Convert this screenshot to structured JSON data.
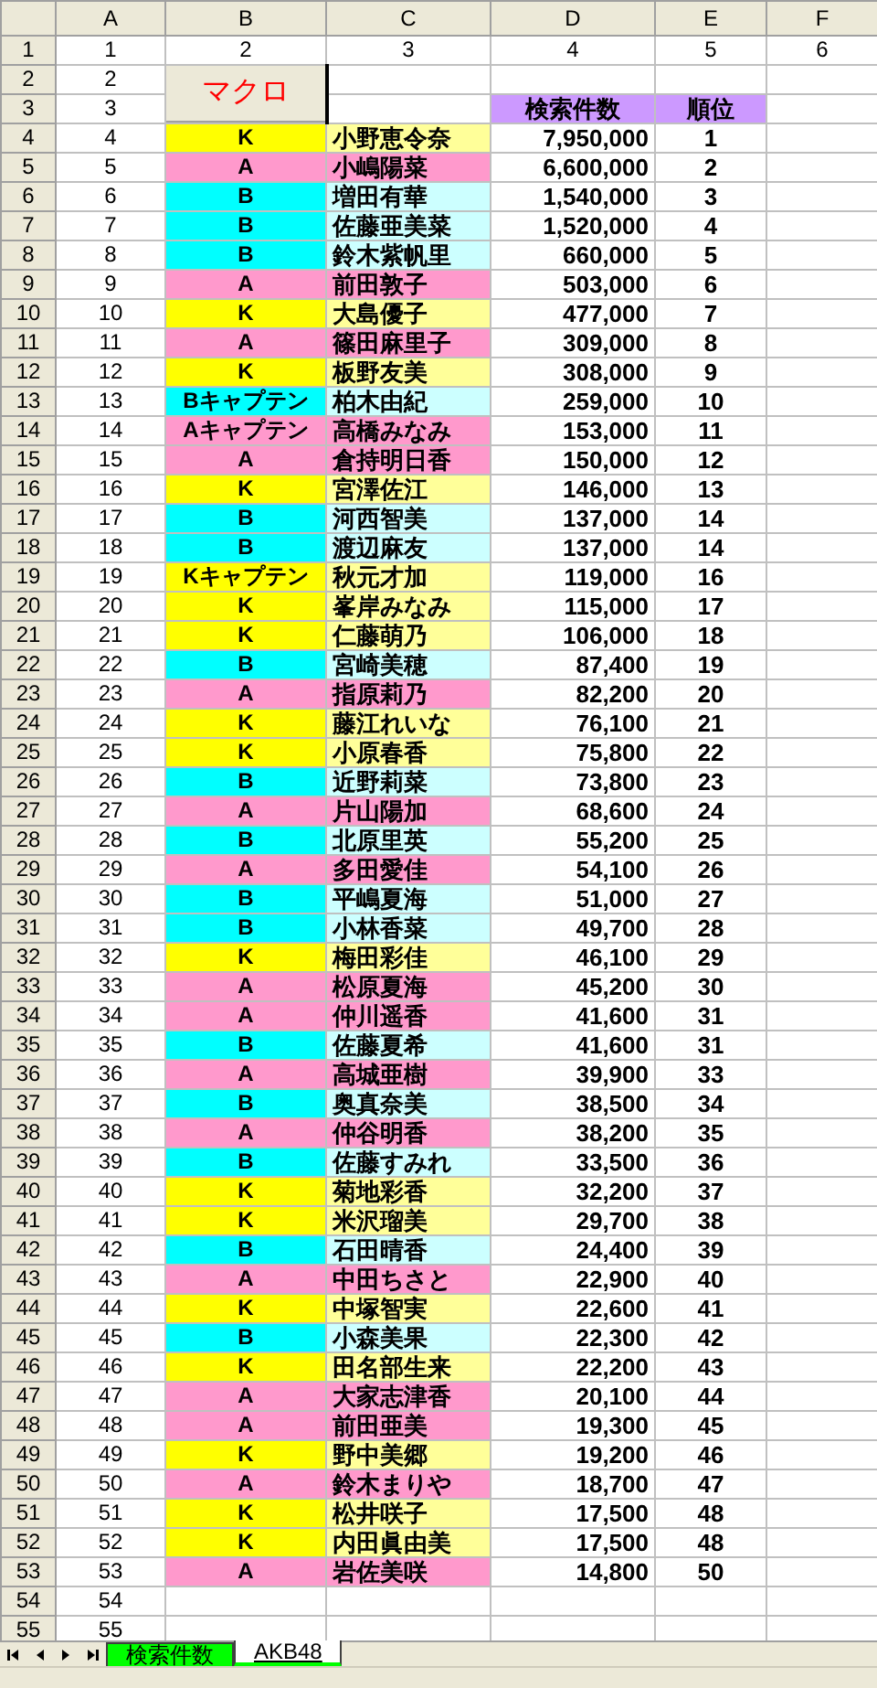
{
  "column_headers": [
    "A",
    "B",
    "C",
    "D",
    "E",
    "F"
  ],
  "row_numbers": [
    "1",
    "2",
    "3",
    "4",
    "5",
    "6",
    "7",
    "8",
    "9",
    "10",
    "11",
    "12",
    "13",
    "14",
    "15",
    "16",
    "17",
    "18",
    "19",
    "20",
    "21",
    "22",
    "23",
    "24",
    "25",
    "26",
    "27",
    "28",
    "29",
    "30",
    "31",
    "32",
    "33",
    "34",
    "35",
    "36",
    "37",
    "38",
    "39",
    "40",
    "41",
    "42",
    "43",
    "44",
    "45",
    "46",
    "47",
    "48",
    "49",
    "50",
    "51",
    "52",
    "53",
    "54",
    "55"
  ],
  "column_a": [
    "1",
    "2",
    "3",
    "4",
    "5",
    "6",
    "7",
    "8",
    "9",
    "10",
    "11",
    "12",
    "13",
    "14",
    "15",
    "16",
    "17",
    "18",
    "19",
    "20",
    "21",
    "22",
    "23",
    "24",
    "25",
    "26",
    "27",
    "28",
    "29",
    "30",
    "31",
    "32",
    "33",
    "34",
    "35",
    "36",
    "37",
    "38",
    "39",
    "40",
    "41",
    "42",
    "43",
    "44",
    "45",
    "46",
    "47",
    "48",
    "49",
    "50",
    "51",
    "52",
    "53",
    "54",
    "55"
  ],
  "row_1": [
    "2",
    "3",
    "4",
    "5",
    "6"
  ],
  "macro_button": "マクロ",
  "headers": {
    "count": "検索件数",
    "rank": "順位"
  },
  "members": [
    {
      "kind": "K",
      "team": "K",
      "name": "小野恵令奈",
      "count": "7,950,000",
      "rank": "1"
    },
    {
      "kind": "A",
      "team": "A",
      "name": "小嶋陽菜",
      "count": "6,600,000",
      "rank": "2"
    },
    {
      "kind": "B",
      "team": "B",
      "name": "増田有華",
      "count": "1,540,000",
      "rank": "3"
    },
    {
      "kind": "B",
      "team": "B",
      "name": "佐藤亜美菜",
      "count": "1,520,000",
      "rank": "4"
    },
    {
      "kind": "B",
      "team": "B",
      "name": "鈴木紫帆里",
      "count": "660,000",
      "rank": "5"
    },
    {
      "kind": "A",
      "team": "A",
      "name": "前田敦子",
      "count": "503,000",
      "rank": "6"
    },
    {
      "kind": "K",
      "team": "K",
      "name": "大島優子",
      "count": "477,000",
      "rank": "7"
    },
    {
      "kind": "A",
      "team": "A",
      "name": "篠田麻里子",
      "count": "309,000",
      "rank": "8"
    },
    {
      "kind": "K",
      "team": "K",
      "name": "板野友美",
      "count": "308,000",
      "rank": "9"
    },
    {
      "kind": "B",
      "team": "Bキャプテン",
      "name": "柏木由紀",
      "count": "259,000",
      "rank": "10"
    },
    {
      "kind": "A",
      "team": "Aキャプテン",
      "name": "高橋みなみ",
      "count": "153,000",
      "rank": "11"
    },
    {
      "kind": "A",
      "team": "A",
      "name": "倉持明日香",
      "count": "150,000",
      "rank": "12"
    },
    {
      "kind": "K",
      "team": "K",
      "name": "宮澤佐江",
      "count": "146,000",
      "rank": "13"
    },
    {
      "kind": "B",
      "team": "B",
      "name": "河西智美",
      "count": "137,000",
      "rank": "14"
    },
    {
      "kind": "B",
      "team": "B",
      "name": "渡辺麻友",
      "count": "137,000",
      "rank": "14"
    },
    {
      "kind": "K",
      "team": "Kキャプテン",
      "name": "秋元才加",
      "count": "119,000",
      "rank": "16"
    },
    {
      "kind": "K",
      "team": "K",
      "name": "峯岸みなみ",
      "count": "115,000",
      "rank": "17"
    },
    {
      "kind": "K",
      "team": "K",
      "name": "仁藤萌乃",
      "count": "106,000",
      "rank": "18"
    },
    {
      "kind": "B",
      "team": "B",
      "name": "宮崎美穂",
      "count": "87,400",
      "rank": "19"
    },
    {
      "kind": "A",
      "team": "A",
      "name": "指原莉乃",
      "count": "82,200",
      "rank": "20"
    },
    {
      "kind": "K",
      "team": "K",
      "name": "藤江れいな",
      "count": "76,100",
      "rank": "21"
    },
    {
      "kind": "K",
      "team": "K",
      "name": "小原春香",
      "count": "75,800",
      "rank": "22"
    },
    {
      "kind": "B",
      "team": "B",
      "name": "近野莉菜",
      "count": "73,800",
      "rank": "23"
    },
    {
      "kind": "A",
      "team": "A",
      "name": "片山陽加",
      "count": "68,600",
      "rank": "24"
    },
    {
      "kind": "B",
      "team": "B",
      "name": "北原里英",
      "count": "55,200",
      "rank": "25"
    },
    {
      "kind": "A",
      "team": "A",
      "name": "多田愛佳",
      "count": "54,100",
      "rank": "26"
    },
    {
      "kind": "B",
      "team": "B",
      "name": "平嶋夏海",
      "count": "51,000",
      "rank": "27"
    },
    {
      "kind": "B",
      "team": "B",
      "name": "小林香菜",
      "count": "49,700",
      "rank": "28"
    },
    {
      "kind": "K",
      "team": "K",
      "name": "梅田彩佳",
      "count": "46,100",
      "rank": "29"
    },
    {
      "kind": "A",
      "team": "A",
      "name": "松原夏海",
      "count": "45,200",
      "rank": "30"
    },
    {
      "kind": "A",
      "team": "A",
      "name": "仲川遥香",
      "count": "41,600",
      "rank": "31"
    },
    {
      "kind": "B",
      "team": "B",
      "name": "佐藤夏希",
      "count": "41,600",
      "rank": "31"
    },
    {
      "kind": "A",
      "team": "A",
      "name": "高城亜樹",
      "count": "39,900",
      "rank": "33"
    },
    {
      "kind": "B",
      "team": "B",
      "name": "奥真奈美",
      "count": "38,500",
      "rank": "34"
    },
    {
      "kind": "A",
      "team": "A",
      "name": "仲谷明香",
      "count": "38,200",
      "rank": "35"
    },
    {
      "kind": "B",
      "team": "B",
      "name": "佐藤すみれ",
      "count": "33,500",
      "rank": "36"
    },
    {
      "kind": "K",
      "team": "K",
      "name": "菊地彩香",
      "count": "32,200",
      "rank": "37"
    },
    {
      "kind": "K",
      "team": "K",
      "name": "米沢瑠美",
      "count": "29,700",
      "rank": "38"
    },
    {
      "kind": "B",
      "team": "B",
      "name": "石田晴香",
      "count": "24,400",
      "rank": "39"
    },
    {
      "kind": "A",
      "team": "A",
      "name": "中田ちさと",
      "count": "22,900",
      "rank": "40"
    },
    {
      "kind": "K",
      "team": "K",
      "name": "中塚智実",
      "count": "22,600",
      "rank": "41"
    },
    {
      "kind": "B",
      "team": "B",
      "name": "小森美果",
      "count": "22,300",
      "rank": "42"
    },
    {
      "kind": "K",
      "team": "K",
      "name": "田名部生来",
      "count": "22,200",
      "rank": "43"
    },
    {
      "kind": "A",
      "team": "A",
      "name": "大家志津香",
      "count": "20,100",
      "rank": "44"
    },
    {
      "kind": "A",
      "team": "A",
      "name": "前田亜美",
      "count": "19,300",
      "rank": "45"
    },
    {
      "kind": "K",
      "team": "K",
      "name": "野中美郷",
      "count": "19,200",
      "rank": "46"
    },
    {
      "kind": "A",
      "team": "A",
      "name": "鈴木まりや",
      "count": "18,700",
      "rank": "47"
    },
    {
      "kind": "K",
      "team": "K",
      "name": "松井咲子",
      "count": "17,500",
      "rank": "48"
    },
    {
      "kind": "K",
      "team": "K",
      "name": "内田眞由美",
      "count": "17,500",
      "rank": "48"
    },
    {
      "kind": "A",
      "team": "A",
      "name": "岩佐美咲",
      "count": "14,800",
      "rank": "50"
    }
  ],
  "sheet_tabs": [
    {
      "label": "検索件数",
      "selected": false,
      "color": "#00ff00"
    },
    {
      "label": "AKB48",
      "selected": true,
      "color": "#00ff00"
    }
  ]
}
